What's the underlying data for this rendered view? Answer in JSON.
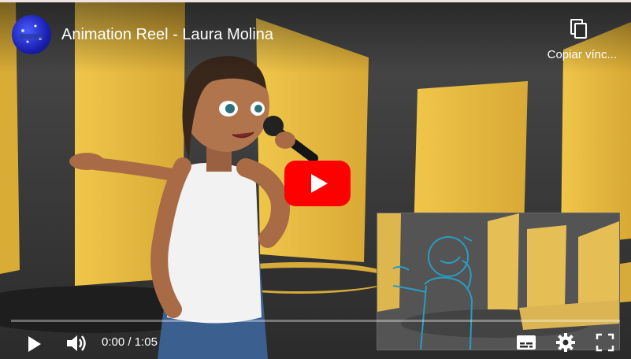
{
  "video": {
    "title": "Animation Reel - Laura Molina",
    "current_time": "0:00",
    "separator": " / ",
    "duration": "1:05",
    "progress": 0
  },
  "actions": {
    "copy_link_label": "Copiar vínc..."
  },
  "colors": {
    "play_button_red": "#ff0000",
    "stage_yellow": "#e5b93e"
  },
  "icons": {
    "copy": "copy-link-icon",
    "play_big": "youtube-play-icon",
    "play": "play-icon",
    "volume": "volume-icon",
    "subtitles": "subtitles-icon",
    "settings": "gear-icon",
    "fullscreen": "fullscreen-icon"
  }
}
